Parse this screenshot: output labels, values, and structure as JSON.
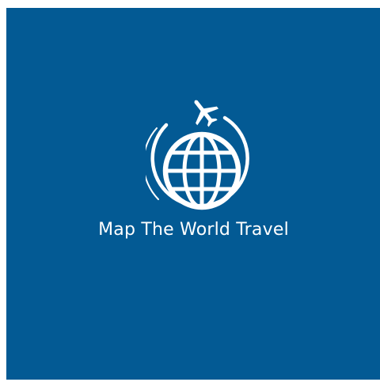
{
  "brand": {
    "name": "Map The World Travel"
  },
  "logo": {
    "icon_names": [
      "globe-icon",
      "airplane-icon",
      "orbit-arc-icon"
    ]
  },
  "colors": {
    "background": "#035a94",
    "foreground": "#ffffff",
    "page": "#ffffff"
  }
}
